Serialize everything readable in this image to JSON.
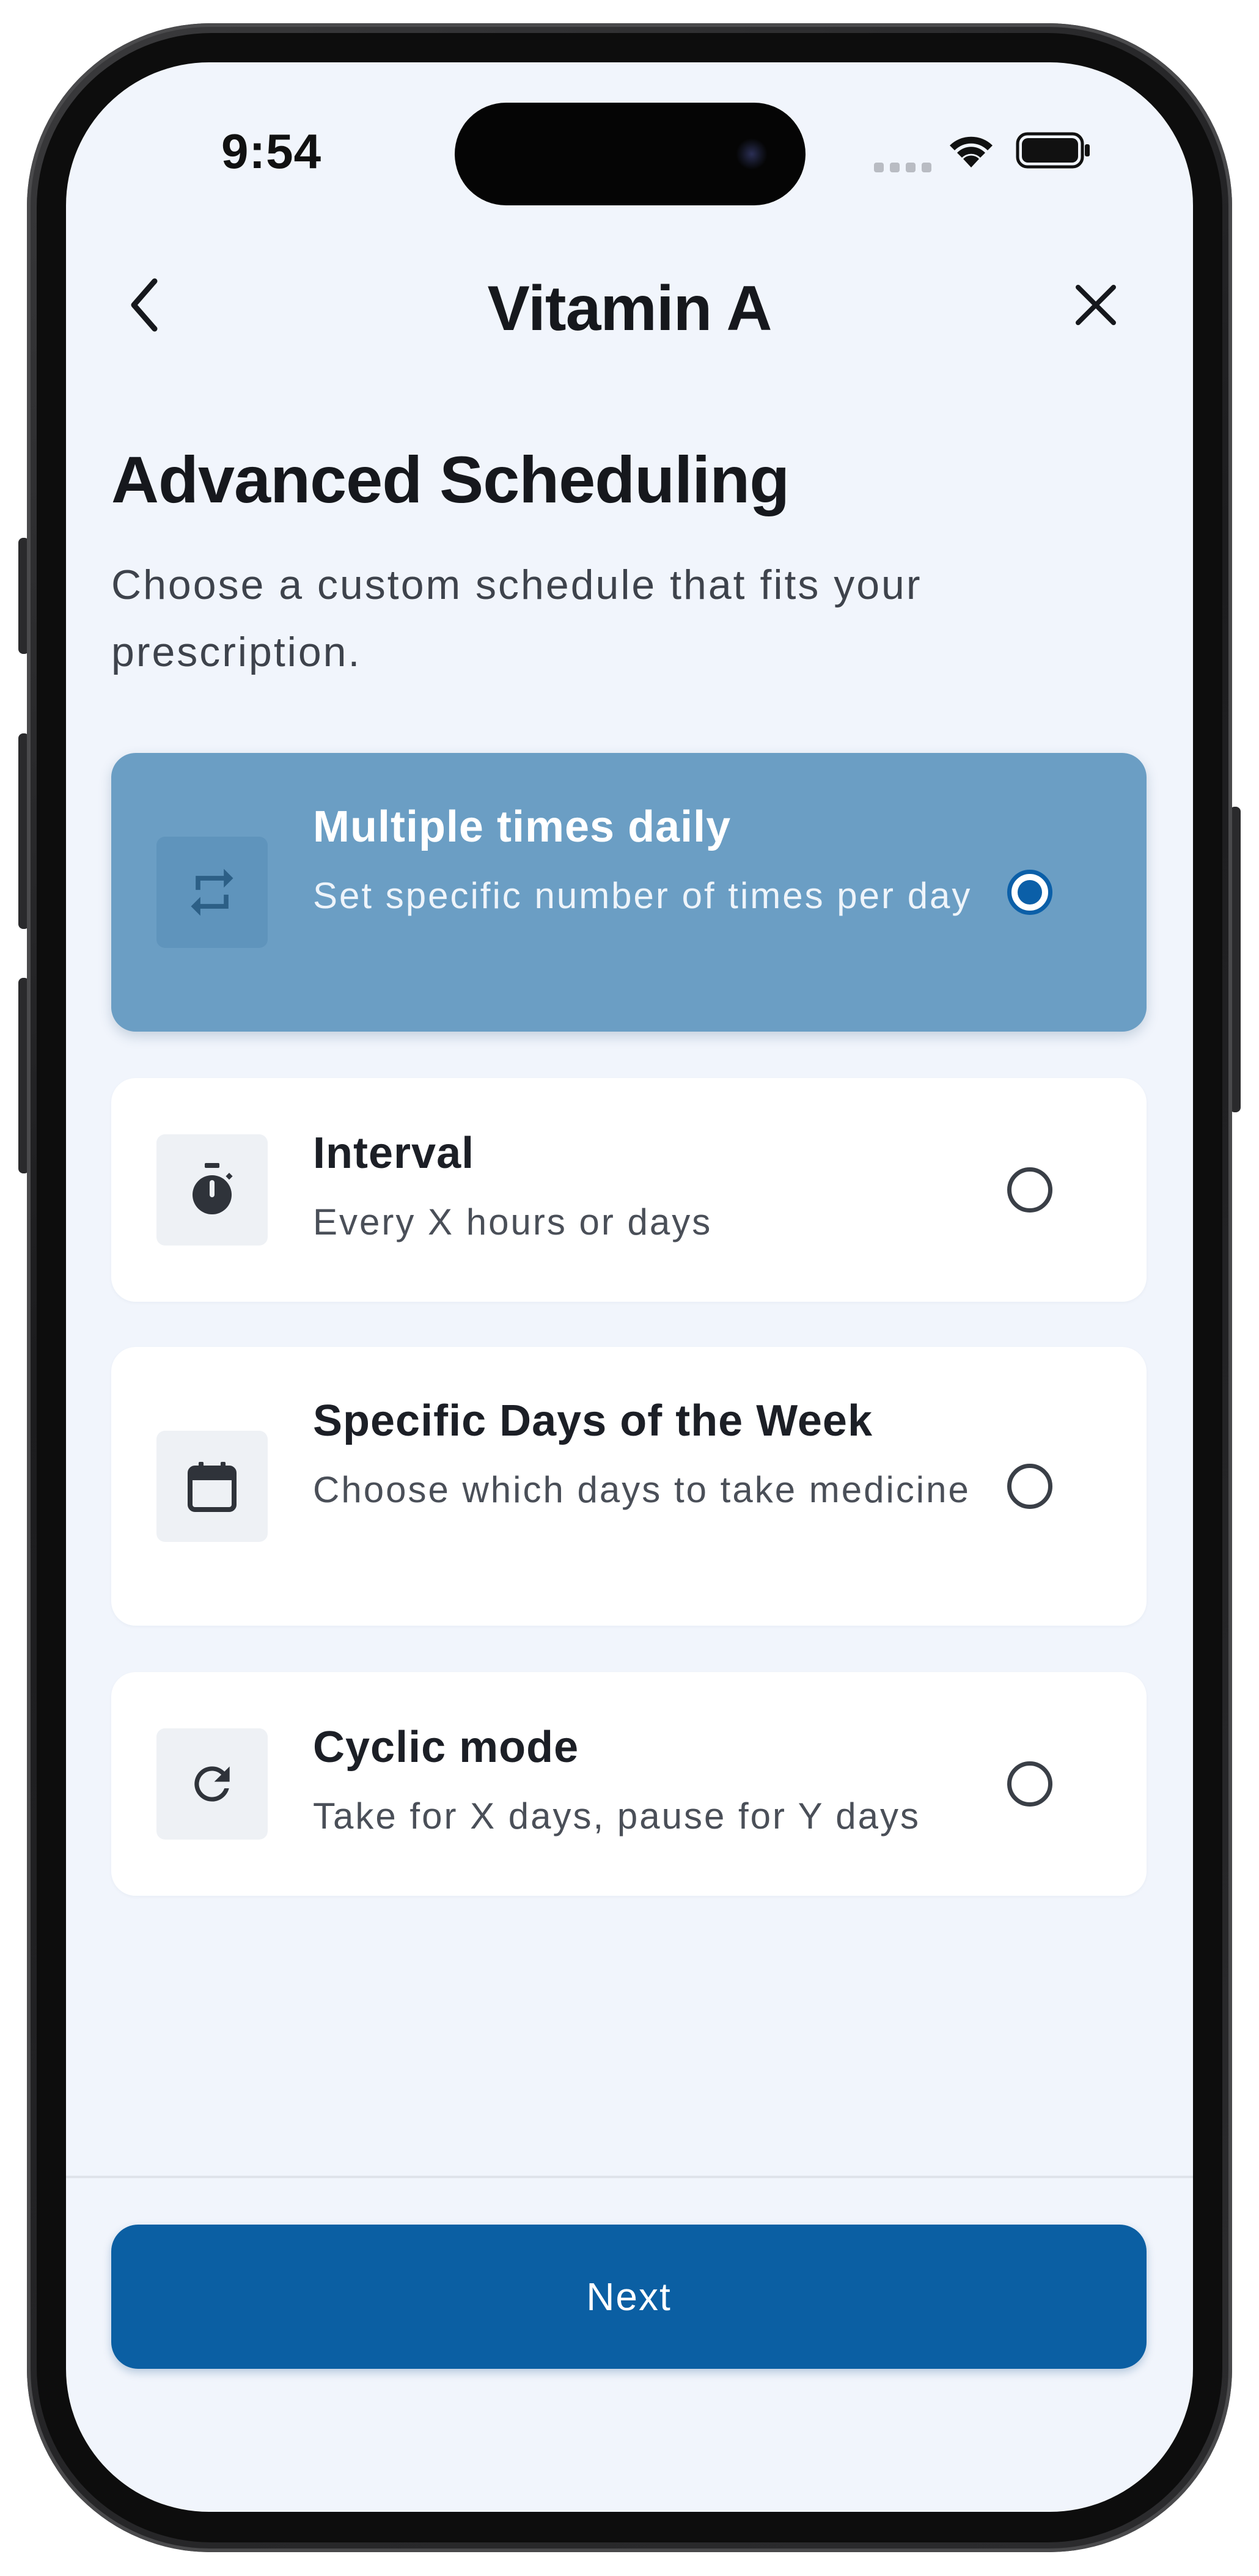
{
  "status_bar": {
    "time": "9:54"
  },
  "header": {
    "title": "Vitamin A",
    "back_icon": "chevron-left-icon",
    "close_icon": "close-icon"
  },
  "section": {
    "title": "Advanced Scheduling",
    "description": "Choose a custom schedule that fits your prescription."
  },
  "options": [
    {
      "icon": "repeat-icon",
      "title": "Multiple times daily",
      "subtitle": "Set specific number of times per day",
      "selected": true
    },
    {
      "icon": "stopwatch-icon",
      "title": "Interval",
      "subtitle": "Every X hours or days",
      "selected": false
    },
    {
      "icon": "calendar-icon",
      "title": "Specific Days of the Week",
      "subtitle": "Choose which days to take medicine",
      "selected": false
    },
    {
      "icon": "refresh-icon",
      "title": "Cyclic mode",
      "subtitle": "Take for X days, pause for Y days",
      "selected": false
    }
  ],
  "footer": {
    "next_label": "Next"
  },
  "colors": {
    "background": "#f1f5fc",
    "selected_card": "#6b9ec4",
    "primary": "#0b5fa3",
    "text": "#16181d"
  }
}
